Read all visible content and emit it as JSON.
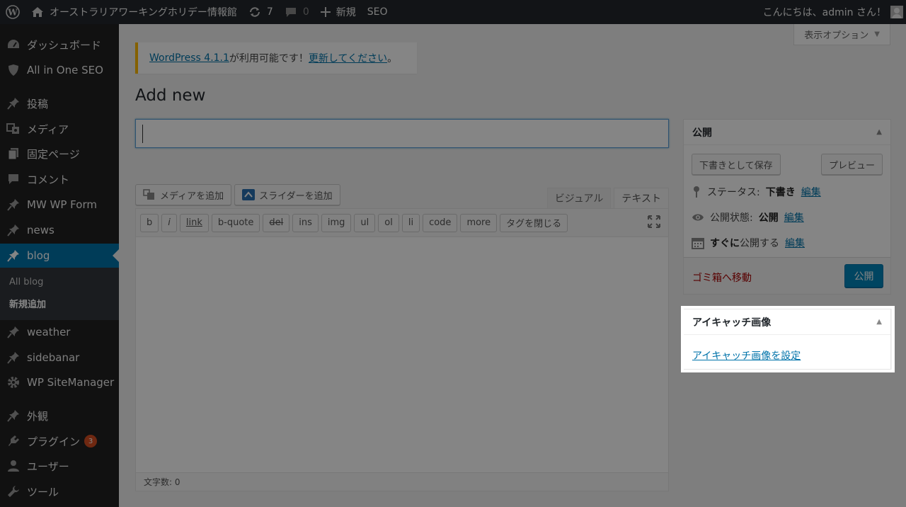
{
  "adminbar": {
    "site_name": "オーストラリアワーキングホリデー情報館",
    "updates_count": "7",
    "comments_count": "0",
    "new_label": "新規",
    "seo_label": "SEO",
    "greeting": "こんにちは、admin さん！"
  },
  "sidebar": {
    "items": [
      {
        "label": "ダッシュボード",
        "icon": "dashboard-icon"
      },
      {
        "label": "All in One SEO",
        "icon": "shield-icon"
      },
      {
        "label": "投稿",
        "icon": "pin-icon"
      },
      {
        "label": "メディア",
        "icon": "media-icon"
      },
      {
        "label": "固定ページ",
        "icon": "page-icon"
      },
      {
        "label": "コメント",
        "icon": "comment-icon"
      },
      {
        "label": "MW WP Form",
        "icon": "pin-icon"
      },
      {
        "label": "news",
        "icon": "pin-icon"
      },
      {
        "label": "blog",
        "icon": "pin-icon"
      },
      {
        "label": "weather",
        "icon": "pin-icon"
      },
      {
        "label": "sidebanar",
        "icon": "pin-icon"
      },
      {
        "label": "WP SiteManager",
        "icon": "gear-icon"
      },
      {
        "label": "外観",
        "icon": "appearance-icon"
      },
      {
        "label": "プラグイン",
        "icon": "plugin-icon"
      },
      {
        "label": "ユーザー",
        "icon": "user-icon"
      },
      {
        "label": "ツール",
        "icon": "wrench-icon"
      }
    ],
    "submenu": [
      "All blog",
      "新規追加"
    ],
    "plugin_badge": "3"
  },
  "screen_options": "表示オプション",
  "notice": {
    "version_link": "WordPress 4.1.1",
    "middle": " が利用可能です！",
    "update_link": "更新してください",
    "end": "。"
  },
  "page_title": "Add new",
  "title_input": {
    "value": ""
  },
  "media_buttons": {
    "add_media": "メディアを追加",
    "add_slider": "スライダーを追加"
  },
  "editor_tabs": {
    "visual": "ビジュアル",
    "text": "テキスト"
  },
  "quicktags": [
    "b",
    "i",
    "link",
    "b-quote",
    "del",
    "ins",
    "img",
    "ul",
    "ol",
    "li",
    "code",
    "more",
    "タグを閉じる"
  ],
  "word_count": "文字数: 0",
  "publish": {
    "title": "公開",
    "save_draft": "下書きとして保存",
    "preview": "プレビュー",
    "status_label": "ステータス:",
    "status_value": "下書き",
    "visibility_label": "公開状態:",
    "visibility_value": "公開",
    "schedule_bold": "すぐに",
    "schedule_rest": "公開する",
    "edit": "編集",
    "trash": "ゴミ箱へ移動",
    "publish_btn": "公開"
  },
  "featured": {
    "title": "アイキャッチ画像",
    "set_link": "アイキャッチ画像を設定"
  },
  "colors": {
    "accent": "#0073aa",
    "sidebar": "#222222",
    "adminbar": "#23282d",
    "notice": "#ffba00",
    "badge": "#d54e21",
    "trash": "#aa0000"
  }
}
